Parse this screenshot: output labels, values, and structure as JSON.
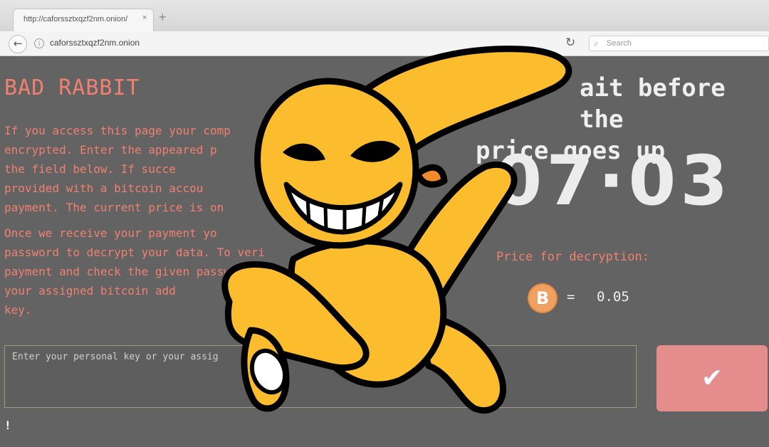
{
  "browser": {
    "tab_title": "http://caforssztxqzf2nm.onion/",
    "tab_close": "×",
    "new_tab": "+",
    "url": "caforssztxqzf2nm.onion",
    "search_placeholder": "Search",
    "icons": {
      "back": "back-arrow-icon",
      "info": "info-icon",
      "refresh": "refresh-icon",
      "search": "search-icon"
    }
  },
  "page": {
    "brand": "BAD RABBIT",
    "paragraph1": "If you access this page your comp\nencrypted. Enter the appeared p\nthe field below. If succe\nprovided with a bitcoin accou\npayment. The current price is on",
    "paragraph2": "Once we receive your payment yo\npassword to decrypt your data. To veri\npayment and check the given passwo\nyour assigned bitcoin add\nkey.",
    "timer_title_line1": "ait before the",
    "timer_title_line2": "price goes up",
    "timer": "·07·03",
    "price_label": "Price for decryption:",
    "btc_symbol": "B",
    "equals": "=",
    "price_value": "0.05",
    "key_placeholder": "Enter your personal key or your assig",
    "submit_label": "✔",
    "footer_mark": "!"
  },
  "colors": {
    "background": "#636363",
    "text_red": "#f08070",
    "button": "#e58d8d",
    "rabbit_yellow": "#fbbd2d",
    "bitcoin": "#f0a060"
  }
}
